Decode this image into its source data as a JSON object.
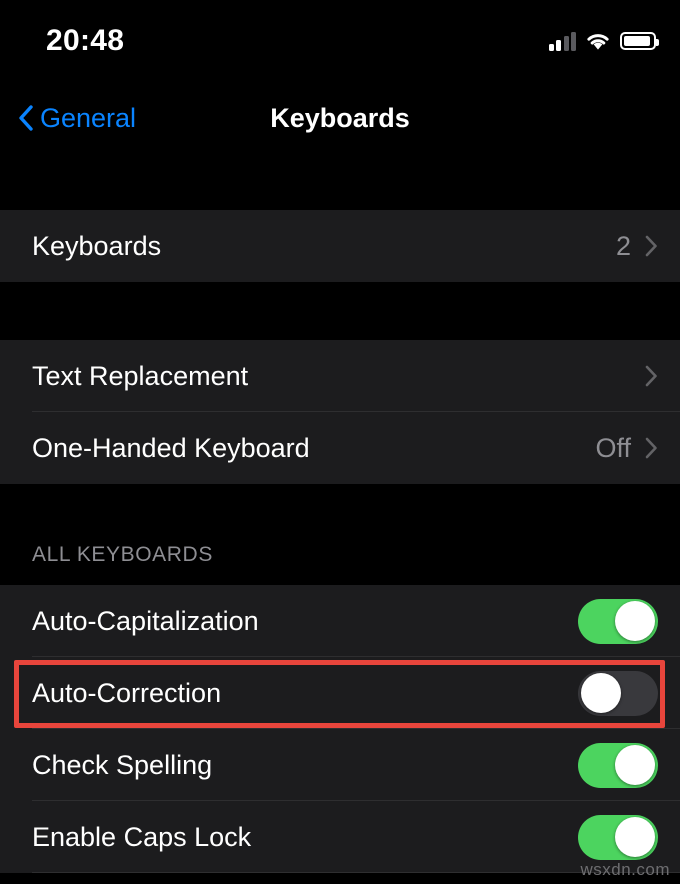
{
  "status_bar": {
    "time": "20:48",
    "signal_icon": "cellular-signal-icon",
    "signal_bars_filled": 2,
    "signal_bars_total": 4,
    "wifi_icon": "wifi-icon",
    "battery_icon": "battery-icon",
    "battery_level_percent": 92
  },
  "nav": {
    "back_label": "General",
    "back_icon": "chevron-left-icon",
    "title": "Keyboards"
  },
  "colors": {
    "accent_blue": "#0A84FF",
    "toggle_on_green": "#4CD45F",
    "toggle_off_gray": "#39393D",
    "highlight_red": "#E8453C",
    "row_background": "#1C1C1E",
    "page_background": "#000000",
    "secondary_text": "#8E8E93"
  },
  "sections": [
    {
      "header": "",
      "rows": [
        {
          "label": "Keyboards",
          "value": "2",
          "type": "disclosure",
          "accessory_icon": "chevron-right-icon"
        }
      ]
    },
    {
      "header": "",
      "rows": [
        {
          "label": "Text Replacement",
          "value": "",
          "type": "disclosure",
          "accessory_icon": "chevron-right-icon"
        },
        {
          "label": "One-Handed Keyboard",
          "value": "Off",
          "type": "disclosure",
          "accessory_icon": "chevron-right-icon"
        }
      ]
    },
    {
      "header": "ALL KEYBOARDS",
      "rows": [
        {
          "label": "Auto-Capitalization",
          "value": "",
          "type": "toggle",
          "toggle_state": "on",
          "highlighted": false
        },
        {
          "label": "Auto-Correction",
          "value": "",
          "type": "toggle",
          "toggle_state": "off",
          "highlighted": true
        },
        {
          "label": "Check Spelling",
          "value": "",
          "type": "toggle",
          "toggle_state": "on",
          "highlighted": false
        },
        {
          "label": "Enable Caps Lock",
          "value": "",
          "type": "toggle",
          "toggle_state": "on",
          "highlighted": false
        }
      ]
    }
  ],
  "watermark": "wsxdn.com"
}
